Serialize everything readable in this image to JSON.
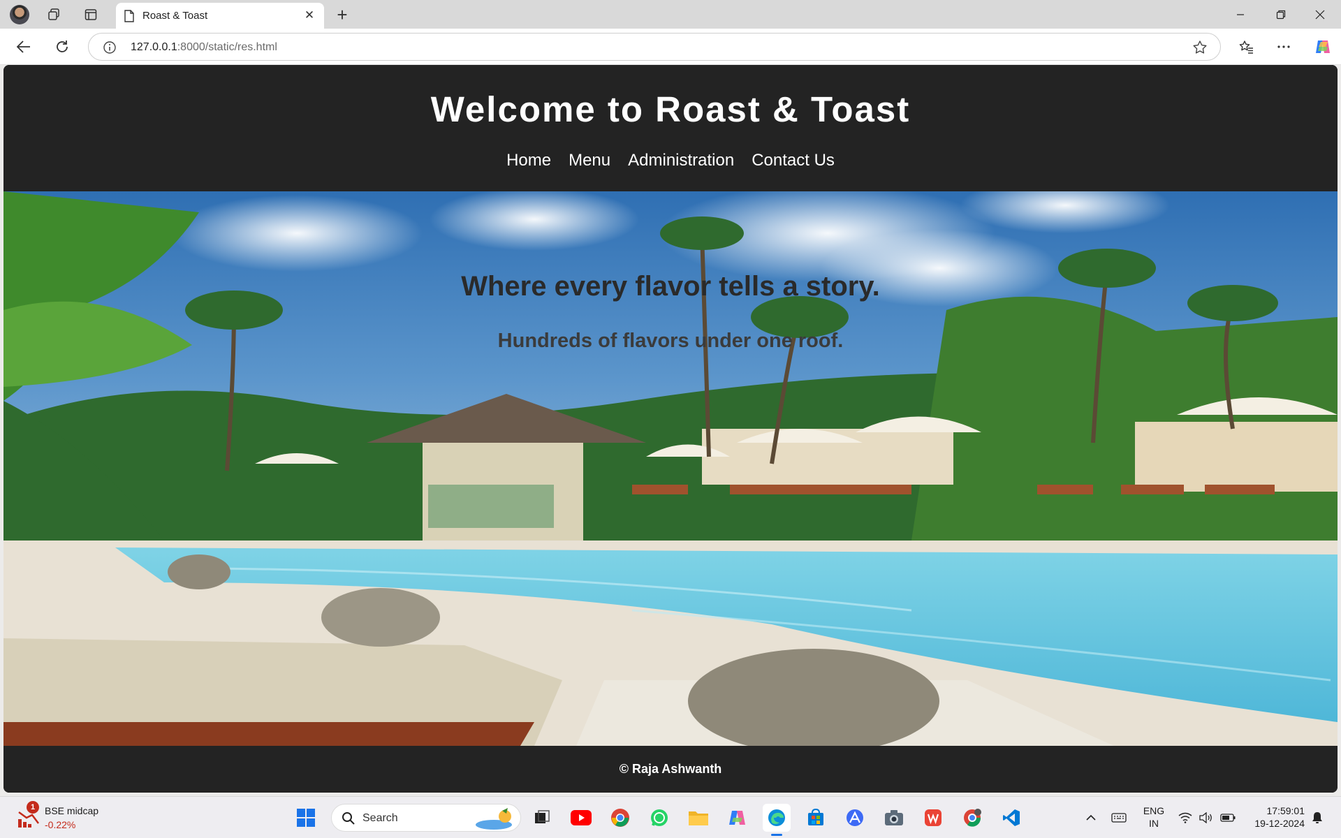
{
  "browser": {
    "tab_title": "Roast & Toast",
    "url_host": "127.0.0.1",
    "url_path": ":8000/static/res.html"
  },
  "site": {
    "title": "Welcome to Roast & Toast",
    "nav": [
      "Home",
      "Menu",
      "Administration",
      "Contact Us"
    ],
    "hero_heading": "Where every flavor tells a story.",
    "hero_subheading": "Hundreds of flavors under one roof.",
    "footer": "© Raja Ashwanth"
  },
  "taskbar": {
    "widget_title": "BSE midcap",
    "widget_value": "-0.22%",
    "widget_badge": "1",
    "search_label": "Search",
    "lang_line1": "ENG",
    "lang_line2": "IN",
    "time": "17:59:01",
    "date": "19-12-2024"
  },
  "colors": {
    "header_bg": "#232323",
    "negative": "#c42b1c"
  }
}
